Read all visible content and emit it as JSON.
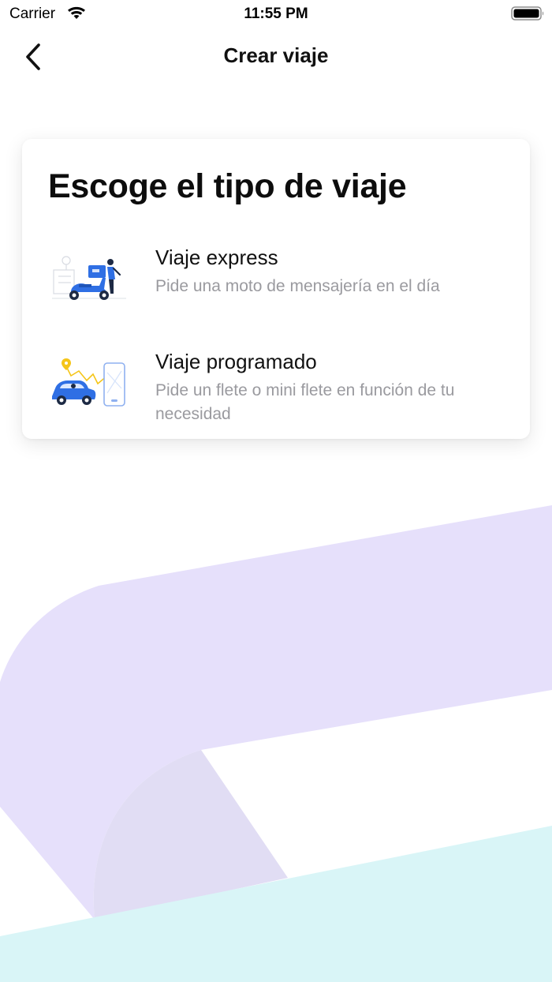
{
  "status_bar": {
    "carrier": "Carrier",
    "time": "11:55 PM"
  },
  "nav": {
    "title": "Crear viaje"
  },
  "card": {
    "title": "Escoge el tipo de viaje",
    "options": [
      {
        "title": "Viaje express",
        "description": "Pide una moto de mensajería en el día",
        "illustration": "scooter-delivery-icon"
      },
      {
        "title": "Viaje programado",
        "description": "Pide un flete o mini flete en función de tu necesidad",
        "illustration": "car-route-phone-icon"
      }
    ]
  },
  "colors": {
    "accent_blue": "#2f6fe4",
    "background_purple": "#e6e0fb",
    "background_cyan": "#d9f5f7",
    "muted_text": "#9a9a9f"
  }
}
